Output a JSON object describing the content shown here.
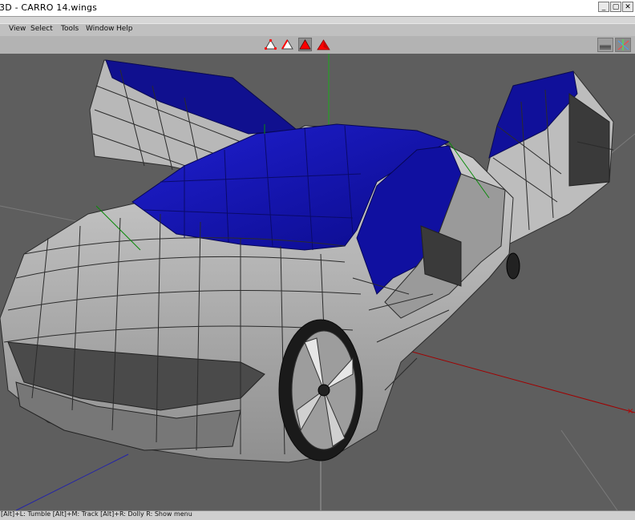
{
  "window": {
    "title": "3D - CARRO 14.wings",
    "controls": [
      "_",
      "▢",
      "✕"
    ]
  },
  "menu": [
    "View",
    "Select",
    "Tools",
    "Window",
    "Help"
  ],
  "toolbar": {
    "modes": [
      {
        "name": "vertex-mode",
        "active": false
      },
      {
        "name": "edge-mode",
        "active": false
      },
      {
        "name": "face-mode",
        "active": true
      },
      {
        "name": "body-mode",
        "active": false
      }
    ],
    "accent": "#ff0000"
  },
  "viewport": {
    "background": "#5e5e5e",
    "model_colors": {
      "body": "#c8c8c8",
      "glass": "#1212a8",
      "wire": "#2e2e2e",
      "edge_highlight": "#00aa00"
    },
    "axis_colors": {
      "x": "#b00000",
      "y": "#00b000",
      "z": "#0000b0"
    }
  },
  "status": {
    "text": "[Alt]+L: Tumble   [Alt]+M: Track   [Alt]+R: Dolly   R: Show menu"
  }
}
